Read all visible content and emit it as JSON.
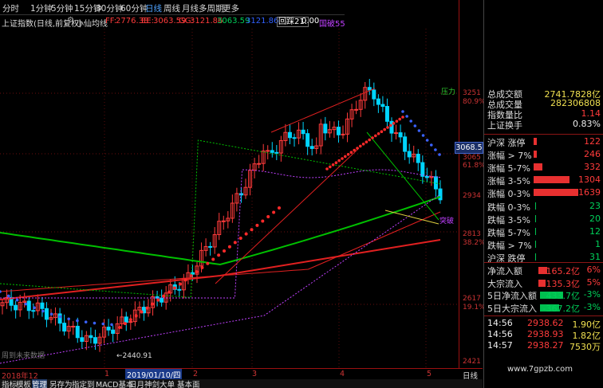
{
  "toolbar": {
    "periods": [
      "分时",
      "1分钟",
      "5分钟",
      "15分钟",
      "30分钟",
      "60分钟",
      "日线",
      "周线",
      "月线",
      "多周期",
      "更多"
    ],
    "active_period": "日线"
  },
  "infobar": {
    "index_name": "上证指数(日线,前复权)",
    "indicator_name": "小仙均线",
    "ff_label": "FF:",
    "ff_value": "2776.38",
    "ee_label": "EE:",
    "ee_value": "3063.59",
    "gg_label": "GG:",
    "gg_value": "3121.86",
    "hh_value": "3063.59",
    "ii_value": "3121.86",
    "huice_label": "回踩21:",
    "huice_value": "0.00",
    "guopo_label": "国破55"
  },
  "price_axis": {
    "labels": [
      "3251",
      "80.9%",
      "3065",
      "61.8%",
      "2934",
      "2813",
      "38.2%",
      "2617",
      "19.1%",
      "2421"
    ],
    "current_price": "3068.5"
  },
  "chart_annotations": {
    "low_label": "2440.91",
    "left_note": "周到未来数据",
    "high_tag": "压力",
    "break_tag": "突破"
  },
  "date_axis": {
    "labels": [
      "2018年12",
      "1",
      "2019/01/10/四",
      "2",
      "3",
      "4",
      "5"
    ],
    "period_label": "日线"
  },
  "bottom_tabs": [
    "指标",
    "模板",
    "管理",
    "另存为",
    "指定到",
    "MACD基本",
    "日月神剑",
    "大单",
    "基本面"
  ],
  "bottom_active": "管理",
  "market_panel": {
    "rows": [
      {
        "label": "总成交额",
        "value": "2741.7828亿",
        "color": "yellow"
      },
      {
        "label": "总成交量",
        "value": "282306808",
        "color": "yellow"
      },
      {
        "label": "指数量比",
        "value": "1.14",
        "color": "red"
      },
      {
        "label": "上证换手",
        "value": "0.83%",
        "color": "white"
      }
    ],
    "updown": [
      {
        "label": "沪深 涨停",
        "value": "122",
        "color": "red",
        "bar": 0.0
      },
      {
        "label": "涨幅 > 7%",
        "value": "246",
        "color": "red",
        "bar": 0.04
      },
      {
        "label": "涨幅 5-7%",
        "value": "332",
        "color": "red",
        "bar": 0.2
      },
      {
        "label": "涨幅 3-5%",
        "value": "1304",
        "color": "red",
        "bar": 0.8
      },
      {
        "label": "涨幅 0-3%",
        "value": "1639",
        "color": "red",
        "bar": 1.0
      },
      {
        "label": "跌幅 0-3%",
        "value": "23",
        "color": "green",
        "bar": 0.0
      },
      {
        "label": "跌幅 3-5%",
        "value": "20",
        "color": "green",
        "bar": 0.0
      },
      {
        "label": "跌幅 5-7%",
        "value": "12",
        "color": "green",
        "bar": 0.0
      },
      {
        "label": "跌幅 > 7%",
        "value": "1",
        "color": "green",
        "bar": 0.0
      },
      {
        "label": "沪深 跌停",
        "value": "31",
        "color": "green",
        "bar": 0.0
      }
    ],
    "flows": [
      {
        "label": "净流入额",
        "value": "165.2亿",
        "pct": "6%",
        "color": "red",
        "bar": 0.25
      },
      {
        "label": "大宗流入",
        "value": "135.3亿",
        "pct": "5%",
        "color": "red",
        "bar": 0.2
      },
      {
        "label": "5日净流入额",
        "value": "433.7亿",
        "pct": "-3%",
        "color": "green",
        "bar": 0.65
      },
      {
        "label": "5日大宗流入",
        "value": "-367.2亿",
        "pct": "-3%",
        "color": "green",
        "bar": 0.55
      }
    ],
    "ticks": [
      {
        "time": "14:56",
        "price": "2938.62",
        "vol": "1.90亿"
      },
      {
        "time": "14:56",
        "price": "2938.93",
        "vol": "1.82亿"
      },
      {
        "time": "14:57",
        "price": "2938.27",
        "vol": "7530万"
      }
    ]
  },
  "watermark": "www.7gpzb.com",
  "colors": {
    "up": "#ff3b3b",
    "down": "#00d5ff",
    "ma_green": "#00c000",
    "ma_red": "#e02020",
    "grid_red": "#9b1010",
    "purple": "#c040ff",
    "accent": "#4fa3ff"
  }
}
